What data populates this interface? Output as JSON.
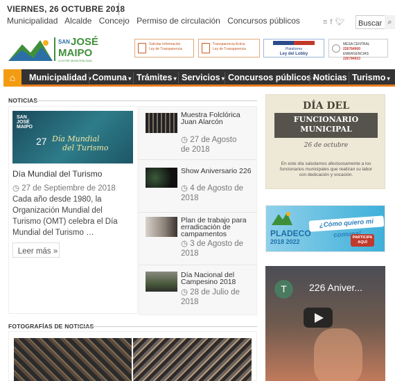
{
  "header": {
    "date": "VIERNES, 26 OCTUBRE 2018",
    "links": [
      "Municipalidad",
      "Alcalde",
      "Concejo",
      "Permiso de circulación",
      "Concursos públicos"
    ],
    "social_icons": [
      "rss-icon",
      "facebook-icon",
      "twitter-icon"
    ],
    "search_value": "Buscar"
  },
  "logo": {
    "line1": "SAN",
    "line2": "JOSÉ",
    "line3": "MAIPO",
    "tag": "ILUSTRE MUNICIPALIDAD"
  },
  "badges": {
    "solicitar": {
      "l1": "Solicitar Información",
      "l2": "Ley de Transparencia"
    },
    "activa": {
      "l1": "Transparencia Activa",
      "l2": "Ley de Transparencia"
    },
    "lobby": {
      "l1": "Plataforma",
      "l2": "Ley del Lobby"
    },
    "mesa": {
      "l1": "MESA CENTRAL",
      "n1": "226784900",
      "l2": "EMERGENCIAS",
      "n2": "226784923"
    }
  },
  "nav": {
    "items": [
      "Municipalidad",
      "Comuna",
      "Trámites",
      "Servicios",
      "Concursos públicos",
      "Noticias",
      "Turismo"
    ],
    "accent": "#e97c1e"
  },
  "news": {
    "section_title": "NOTICIAS",
    "featured": {
      "image_text_1": "27",
      "image_text_2": "Día Mundial",
      "image_text_3": "del Turismo",
      "image_logo": "SAN JOSÉ MAIPO",
      "title": "Día Mundial del Turismo",
      "date": "27 de Septiembre de 2018",
      "excerpt": "Cada año desde 1980, la Organización Mundial del Turismo (OMT) celebra el Día Mundial del Turismo …",
      "more": "Leer más »"
    },
    "list": [
      {
        "title": "Muestra Folclórica Juan Alarcón",
        "date_a": "27 de Agosto",
        "date_b": "de 2018"
      },
      {
        "title": "Show Aniversario 226",
        "date_a": "4 de Agosto de",
        "date_b": "2018"
      },
      {
        "title": "Plan de trabajo para erradicación de campamentos",
        "date_a": "3 de Agosto de",
        "date_b": "2018"
      },
      {
        "title": "Día Nacional del Campesino 2018",
        "date_a": "28 de Julio de",
        "date_b": "2018"
      }
    ]
  },
  "photos": {
    "section_title": "FOTOGRAFÍAS DE NOTICIAS"
  },
  "sidebar": {
    "funcionario": {
      "heading": "DÍA DEL",
      "ribbon1": "FUNCIONARIO",
      "ribbon2": "MUNICIPAL",
      "date": "26 de octubre",
      "body": "En este día saludamos afectuosamente a los funcionarios municipales que realizan su labor con dedicación y vocación."
    },
    "pladeco": {
      "name": "PLADECO",
      "years": "2018 2022",
      "slogan": "¿Cómo quiero mi comuna!",
      "cta1": "PARTICIPA",
      "cta2": "AQUÍ"
    },
    "video": {
      "avatar_letter": "T",
      "title": "226 Aniver..."
    }
  }
}
